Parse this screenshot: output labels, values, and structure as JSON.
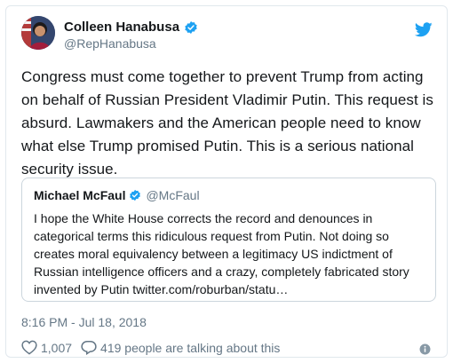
{
  "author": {
    "name": "Colleen Hanabusa",
    "handle": "@RepHanabusa"
  },
  "tweet_text": "Congress must come together to prevent Trump from acting on behalf of Russian President Vladimir Putin. This request is absurd. Lawmakers and the American people need to know what else Trump promised Putin. This is a serious national security issue.",
  "quoted_tweet": {
    "name": "Michael McFaul",
    "handle": "@McFaul",
    "text": "I hope the White House corrects the record and denounces in categorical terms this ridiculous request from Putin. Not doing so creates moral equivalency between a legitimacy US indictment of Russian intelligence officers and a crazy, completely fabricated story invented by Putin twitter.com/roburban/statu…"
  },
  "timestamp": "8:16 PM - Jul 18, 2018",
  "actions": {
    "likes": "1,007",
    "talking": "419 people are talking about this"
  },
  "colors": {
    "twitter_blue": "#1da1f2",
    "secondary_text": "#657786",
    "border": "#e1e8ed"
  },
  "icons": {
    "bird": "twitter-bird-icon",
    "verified": "verified-badge-icon",
    "like": "heart-icon",
    "reply": "speech-bubble-icon",
    "info": "info-icon"
  }
}
